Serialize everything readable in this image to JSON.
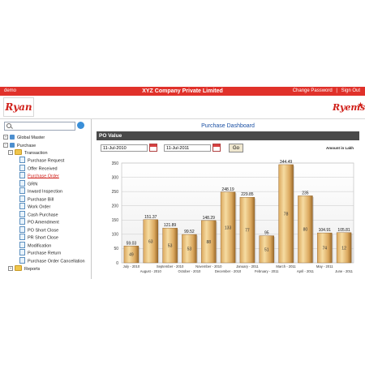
{
  "header": {
    "user": "demo",
    "company": "XYZ Company Private Limited",
    "change_password": "Change Password",
    "separator": "|",
    "sign_out": "Sign Out"
  },
  "logos": {
    "left": "Ryan",
    "right": "Ryems"
  },
  "sidebar": {
    "items": [
      {
        "label": "Global Master"
      },
      {
        "label": "Purchase"
      },
      {
        "label": "Transaction"
      },
      {
        "label": "Purchase Request"
      },
      {
        "label": "Offer Received"
      },
      {
        "label": "Purchase Order"
      },
      {
        "label": "GRN"
      },
      {
        "label": "Inward Inspection"
      },
      {
        "label": "Purchase Bill"
      },
      {
        "label": "Work Order"
      },
      {
        "label": "Cash Purchase"
      },
      {
        "label": "PO Amendment"
      },
      {
        "label": "PO Short Close"
      },
      {
        "label": "PR Short Close"
      },
      {
        "label": "Modification"
      },
      {
        "label": "Purchase Return"
      },
      {
        "label": "Purchase Order Cancellation"
      },
      {
        "label": "Reports"
      }
    ]
  },
  "main": {
    "dashboard_title": "Purchase Dashboard",
    "section_title": "PO Value",
    "from_date": "11-Jul-2010",
    "to_date": "11-Jul-2011",
    "go_label": "Go",
    "amount_note": "Amount in Lakh"
  },
  "chart_data": {
    "type": "bar",
    "categories": [
      "July - 2010",
      "August - 2010",
      "September - 2010",
      "October - 2010",
      "November - 2010",
      "December - 2010",
      "January - 2011",
      "February - 2011",
      "March - 2011",
      "April - 2011",
      "May - 2011",
      "June - 2011"
    ],
    "values": [
      59.03,
      151.37,
      121.89,
      99.52,
      148.29,
      248.19,
      229.85,
      95,
      344.49,
      235,
      104.91,
      105.81
    ],
    "inner_labels": [
      "49",
      "63",
      "53",
      "53",
      "88",
      "133",
      "77",
      "51",
      "78",
      "80",
      "74",
      "12"
    ],
    "ylim": [
      0,
      350
    ],
    "yticks": [
      0,
      50,
      100,
      150,
      200,
      250,
      300,
      350
    ],
    "grid": true,
    "colors": {
      "bar_light": "#f6dca2",
      "bar_mid": "#dba85e",
      "bar_dark": "#9b6a2a",
      "grid": "#c8c8c8"
    }
  }
}
